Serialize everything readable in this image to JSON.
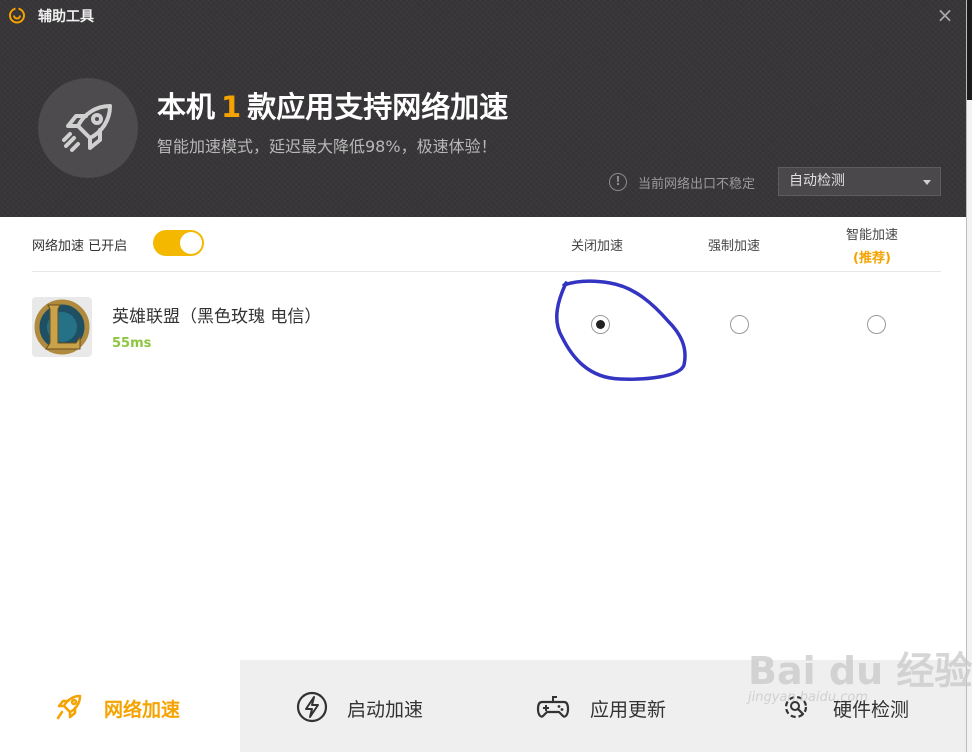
{
  "window": {
    "title": "辅助工具",
    "close_glyph": "×"
  },
  "header": {
    "headline_prefix": "本机",
    "headline_count": "1",
    "headline_suffix": "款应用支持网络加速",
    "subline": "智能加速模式，延迟最大降低98%，极速体验！",
    "warning_glyph": "!",
    "warning_text": "当前网络出口不稳定",
    "detect_select": "自动检测",
    "accent_color": "#f5a300"
  },
  "settings": {
    "accel_label": "网络加速 已开启",
    "accel_enabled": true,
    "columns": {
      "off": "关闭加速",
      "force": "强制加速",
      "smart": "智能加速",
      "smart_note": "(推荐)"
    }
  },
  "apps": [
    {
      "name": "英雄联盟（黑色玫瑰 电信）",
      "ping": "55ms",
      "icon": "league-of-legends-logo",
      "mode": "off"
    }
  ],
  "tabs": [
    {
      "label": "网络加速",
      "icon": "rocket-icon",
      "active": true
    },
    {
      "label": "启动加速",
      "icon": "lightning-icon",
      "active": false
    },
    {
      "label": "应用更新",
      "icon": "gamepad-icon",
      "active": false
    },
    {
      "label": "硬件检测",
      "icon": "gear-search-icon",
      "active": false
    }
  ],
  "watermark": {
    "text": "Bai du 经验",
    "sub": "jingyan.baidu.com"
  }
}
